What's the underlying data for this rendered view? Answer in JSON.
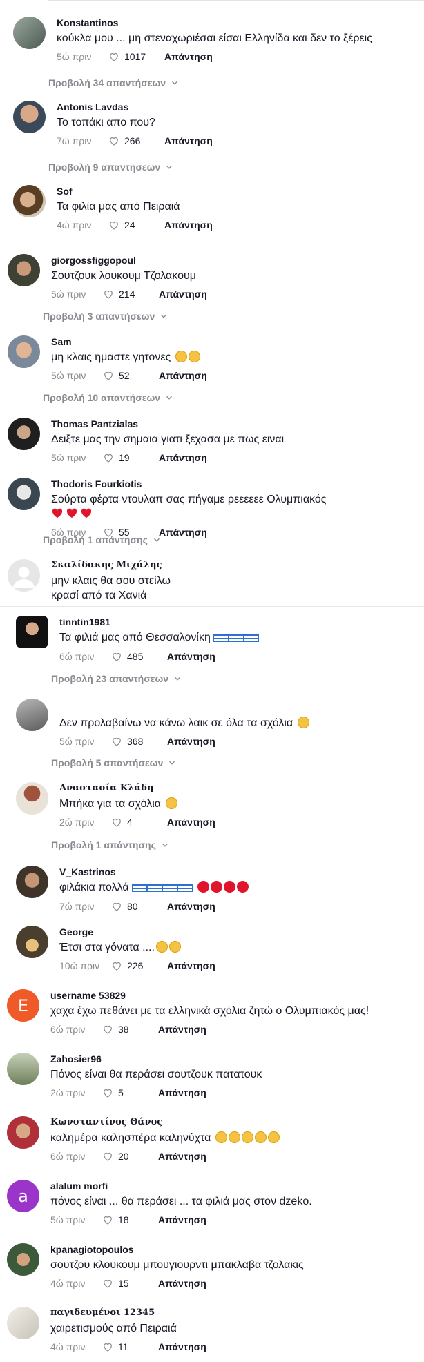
{
  "labels": {
    "reply": "Απάντηση"
  },
  "comments": [
    {
      "user": "Konstantinos",
      "text": "κούκλα μου ... μη στεναχωριέσαι είσαι Ελληνίδα και δεν το ξέρεις",
      "time": "5ώ πριν",
      "likes": "1017",
      "replies": "Προβολή 34 απαντήσεων",
      "avatar_color": "#6b7a6e"
    },
    {
      "user": "Antonis Lavdas",
      "text": "Το τοπάκι απο που?",
      "time": "7ώ πριν",
      "likes": "266",
      "replies": "Προβολή 9 απαντήσεων",
      "avatar_color": "#8a6a55"
    },
    {
      "user": "Sof",
      "text": "Τα φιλία μας από Πειραιά",
      "time": "4ώ πριν",
      "likes": "24",
      "avatar_color": "#7a5a3a"
    },
    {
      "user": "giorgossfiggopoul",
      "text": "Σουτζουκ λουκουμ Τζολακουμ",
      "time": "5ώ πριν",
      "likes": "214",
      "replies": "Προβολή 3 απαντήσεων",
      "avatar_color": "#4a4f3e"
    },
    {
      "user": "Sam",
      "text": "μη κλαις ημαστε γητονες",
      "time": "5ώ πριν",
      "likes": "52",
      "replies": "Προβολή 10 απαντήσεων",
      "avatar_color": "#b4876a"
    },
    {
      "user": "Thomas Pantzialas",
      "text": "Δειξτε μας την σημαια γιατι ξεχασα με πως ειναι",
      "time": "5ώ πριν",
      "likes": "19",
      "avatar_color": "#2b2b2b"
    },
    {
      "user": "Thodoris Fourkiotis",
      "text": "Σούρτα φέρτα ντουλαπ σας πήγαμε ρεεεεεε Ολυμπιακός",
      "time": "6ώ πριν",
      "likes": "55",
      "replies": "Προβολή 1 απάντησης",
      "avatar_color": "#3a4750"
    },
    {
      "user": "Σκαλίδακης Μιχάλης",
      "text": "μην κλαις θα σου στείλω\nκρασί από τα Χανιά",
      "avatar_color": "#d9d9d9"
    },
    {
      "user": "tinntin1981",
      "text": "Τα φιλιά μας από Θεσσαλονίκη",
      "time": "6ώ πριν",
      "likes": "485",
      "replies": "Προβολή 23 απαντήσεων",
      "avatar_color": "#1e1e1e"
    },
    {
      "user": "",
      "text": "Δεν προλαβαίνω να κάνω λαικ σε όλα τα σχόλια",
      "time": "5ώ πριν",
      "likes": "368",
      "replies": "Προβολή 5 απαντήσεων",
      "avatar_color": "#8e8e8e"
    },
    {
      "user": "Αναστασία Κλάδη",
      "text": "Μπήκα για τα σχόλια",
      "time": "2ώ πριν",
      "likes": "4",
      "replies": "Προβολή 1 απάντησης",
      "avatar_color": "#a0523c"
    },
    {
      "user": "V_Kastrinos",
      "text": "φιλάκια πολλά",
      "time": "7ώ πριν",
      "likes": "80",
      "avatar_color": "#5a4a3a"
    },
    {
      "user": "George",
      "text": "Έτσι στα γόνατα ....",
      "time": "10ώ πριν",
      "likes": "226",
      "avatar_color": "#4a3e2e"
    },
    {
      "user": "username 53829",
      "text": "χαχα έχω πεθάνει με τα ελληνικά σχόλια ζητώ ο Ολυμπιακός μας!",
      "time": "6ώ πριν",
      "likes": "38",
      "avatar_letter": "E",
      "avatar_color": "#f05a28"
    },
    {
      "user": "Zahosier96",
      "text": "Πόνος είναι θα περάσει σουτζουκ πατατουκ",
      "time": "2ώ πριν",
      "likes": "5",
      "avatar_color": "#9aa58a"
    },
    {
      "user": "Κωνσταντίνος Θάνος",
      "text": "καλημέρα καλησπέρα καληνύχτα",
      "time": "6ώ πριν",
      "likes": "20",
      "avatar_color": "#b0303a"
    },
    {
      "user": "alalum morfi",
      "text": "πόνος είναι ... θα περάσει ... τα φιλιά μας στον dzeko.",
      "time": "5ώ πριν",
      "likes": "18",
      "avatar_letter": "a",
      "avatar_color": "#9b35c9"
    },
    {
      "user": "kpanagiotopoulos",
      "text": "σουτζου κλουκουμ μπουγιουρντι μπακλαβα τζολακις",
      "time": "4ώ πριν",
      "likes": "15",
      "avatar_color": "#3c5a3a"
    },
    {
      "user": "παγιδευμένοι 12345",
      "text": "χαιρετισμούς από Πειραιά",
      "time": "4ώ πριν",
      "likes": "11",
      "avatar_color": "#e8e4dc"
    }
  ]
}
